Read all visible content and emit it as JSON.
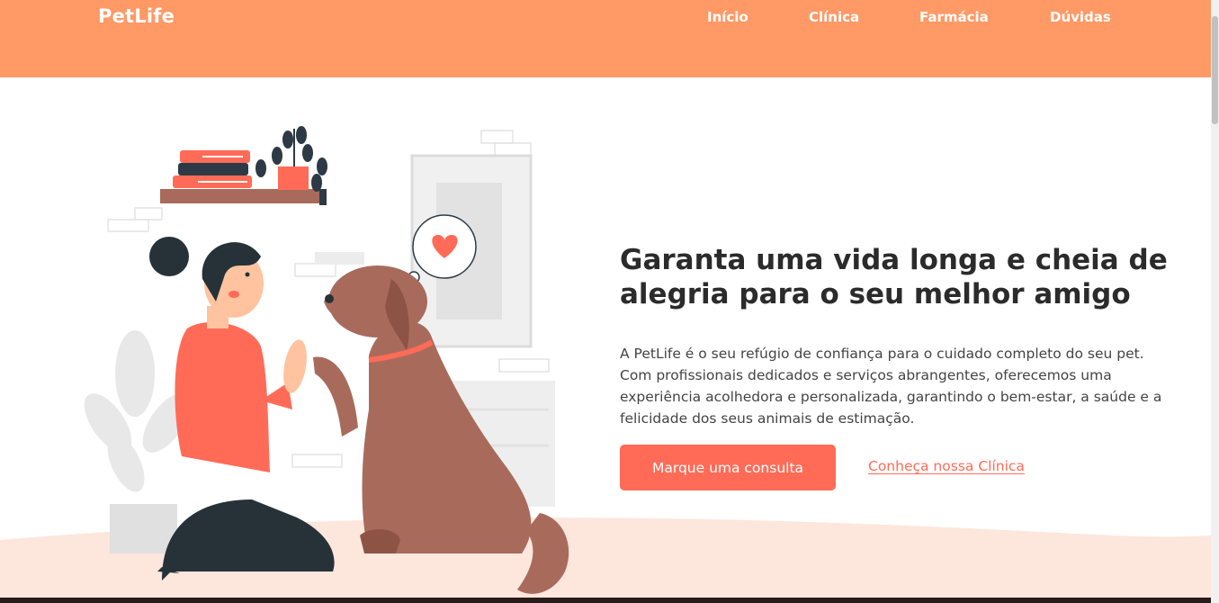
{
  "header": {
    "logo": "PetLife",
    "nav": [
      "Início",
      "Clínica",
      "Farmácia",
      "Dúvidas"
    ]
  },
  "hero": {
    "title": "Garanta uma vida longa e cheia de alegria para o seu melhor amigo",
    "description": "A PetLife é o seu refúgio de confiança para o cuidado completo do seu pet. Com profissionais dedicados e serviços abrangentes, oferecemos uma experiência acolhedora e personalizada, garantindo o bem-estar, a saúde e a felicidade dos seus animais de estimação.",
    "primary_button": "Marque uma consulta",
    "secondary_link": "Conheça nossa Clínica"
  },
  "colors": {
    "header": "#ff9966",
    "accent": "#ff6b57",
    "dog": "#a86b5b",
    "shirt": "#ff6b57",
    "floor": "#fde6dc"
  },
  "illustration": {
    "icon": "heart-icon"
  }
}
